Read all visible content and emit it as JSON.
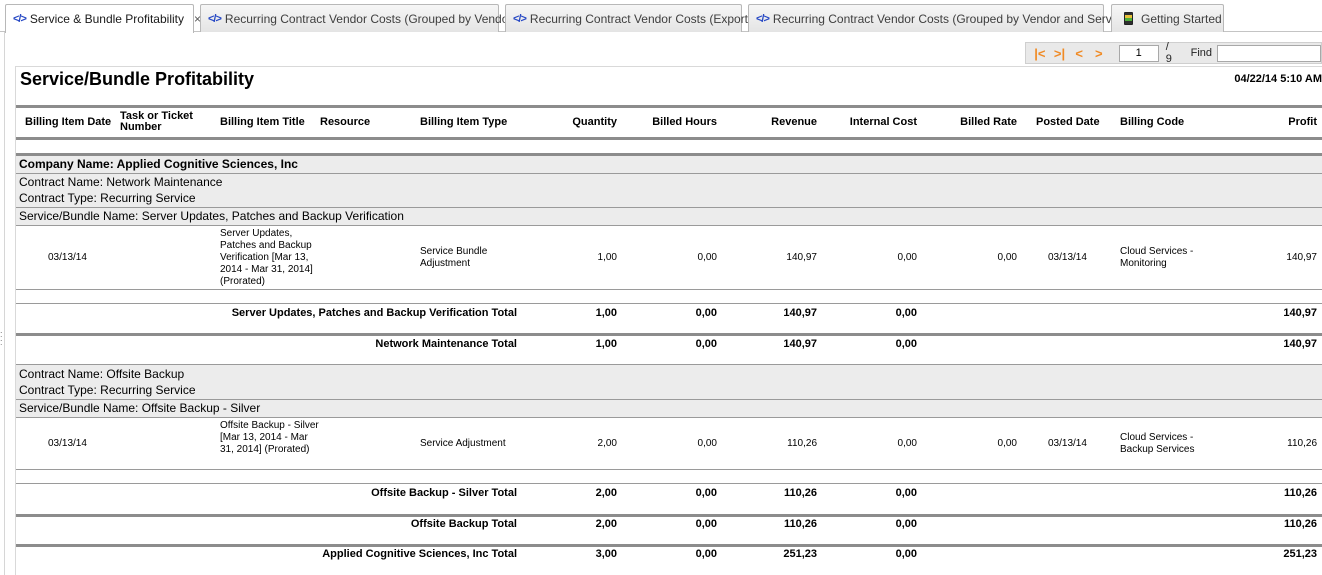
{
  "tabs": [
    {
      "label": "Service & Bundle Profitability",
      "icon": "code-icon",
      "active": true,
      "close": "×"
    },
    {
      "label": "Recurring Contract Vendor Costs (Grouped by Vendor)",
      "icon": "code-icon"
    },
    {
      "label": "Recurring Contract Vendor Costs (Export)",
      "icon": "code-icon"
    },
    {
      "label": "Recurring Contract Vendor Costs (Grouped by Vendor and Service)",
      "icon": "code-icon"
    },
    {
      "label": "Getting Started",
      "icon": "traffic-light-icon"
    }
  ],
  "toolbar": {
    "first": "|<",
    "last": ">|",
    "prev": "<",
    "next": ">",
    "page": "1",
    "total": "/ 9",
    "find_label": "Find",
    "find_value": ""
  },
  "report": {
    "title": "Service/Bundle Profitability",
    "timestamp": "04/22/14 5:10 AM",
    "columns": {
      "billing_item_date": "Billing Item Date",
      "task": "Task or Ticket Number",
      "billing_item_title": "Billing Item Title",
      "resource": "Resource",
      "billing_item_type": "Billing Item Type",
      "quantity": "Quantity",
      "billed_hours": "Billed Hours",
      "revenue": "Revenue",
      "internal_cost": "Internal Cost",
      "billed_rate": "Billed Rate",
      "posted_date": "Posted Date",
      "billing_code": "Billing Code",
      "profit": "Profit"
    },
    "company": "Company Name: Applied Cognitive Sciences, Inc",
    "contracts": [
      {
        "name": "Contract Name: Network Maintenance",
        "type": "Contract Type: Recurring Service",
        "bundle": "Service/Bundle Name: Server Updates, Patches and Backup Verification",
        "row": {
          "date": "03/13/14",
          "title": "Server Updates, Patches and Backup Verification [Mar 13, 2014 - Mar 31, 2014] (Prorated)",
          "type": "Service Bundle Adjustment",
          "quantity": "1,00",
          "hours": "0,00",
          "revenue": "140,97",
          "cost": "0,00",
          "rate": "0,00",
          "posted": "03/13/14",
          "code": "Cloud Services - Monitoring",
          "profit": "140,97"
        },
        "bundle_total": {
          "label": "Server Updates, Patches and Backup Verification Total",
          "quantity": "1,00",
          "hours": "0,00",
          "revenue": "140,97",
          "cost": "0,00",
          "profit": "140,97"
        },
        "contract_total": {
          "label": "Network Maintenance Total",
          "quantity": "1,00",
          "hours": "0,00",
          "revenue": "140,97",
          "cost": "0,00",
          "profit": "140,97"
        }
      },
      {
        "name": "Contract Name: Offsite Backup",
        "type": "Contract Type: Recurring Service",
        "bundle": "Service/Bundle Name: Offsite Backup - Silver",
        "row": {
          "date": "03/13/14",
          "title": "Offsite Backup - Silver [Mar 13, 2014 - Mar 31, 2014] (Prorated)",
          "type": "Service Adjustment",
          "quantity": "2,00",
          "hours": "0,00",
          "revenue": "110,26",
          "cost": "0,00",
          "rate": "0,00",
          "posted": "03/13/14",
          "code": "Cloud Services - Backup Services",
          "profit": "110,26"
        },
        "bundle_total": {
          "label": "Offsite Backup - Silver Total",
          "quantity": "2,00",
          "hours": "0,00",
          "revenue": "110,26",
          "cost": "0,00",
          "profit": "110,26"
        },
        "contract_total": {
          "label": "Offsite Backup Total",
          "quantity": "2,00",
          "hours": "0,00",
          "revenue": "110,26",
          "cost": "0,00",
          "profit": "110,26"
        }
      }
    ],
    "company_total": {
      "label": "Applied Cognitive Sciences, Inc Total",
      "quantity": "3,00",
      "hours": "0,00",
      "revenue": "251,23",
      "cost": "0,00",
      "profit": "251,23"
    }
  }
}
